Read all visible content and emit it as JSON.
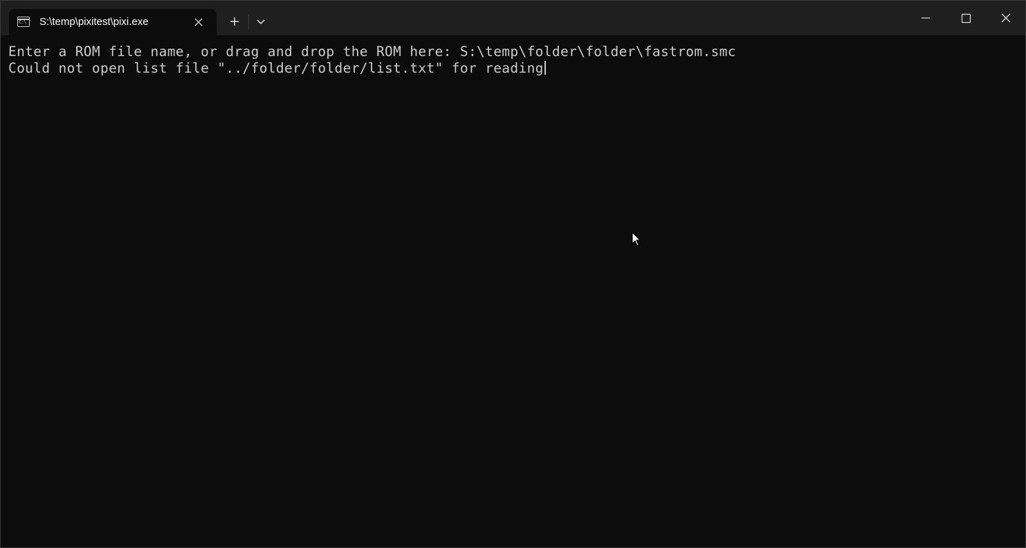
{
  "tab": {
    "title": "S:\\temp\\pixitest\\pixi.exe",
    "icon": "command-prompt-icon",
    "icon_glyph": "C:\\"
  },
  "titlebar": {
    "new_tab_icon": "plus-icon",
    "dropdown_icon": "chevron-down-icon",
    "minimize_icon": "minimize-icon",
    "maximize_icon": "maximize-icon",
    "close_icon": "close-icon"
  },
  "terminal": {
    "lines": [
      "Enter a ROM file name, or drag and drop the ROM here: S:\\temp\\folder\\folder\\fastrom.smc",
      "Could not open list file \"../folder/folder/list.txt\" for reading"
    ]
  },
  "colors": {
    "background": "#0c0c0c",
    "titlebar": "#1f1f1f",
    "text": "#cccccc"
  }
}
